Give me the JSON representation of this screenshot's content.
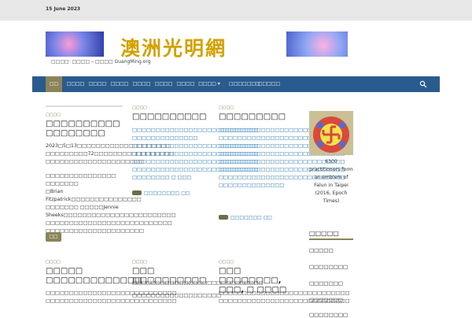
{
  "topbar": {
    "date": "15 June 2023"
  },
  "banner": {
    "title": "澳洲光明網",
    "tagline": "□□□□· □□□□ – □□□□ GuangMing.org"
  },
  "nav": {
    "items": [
      "□□",
      "□□□□",
      "□□□□",
      "□□□□",
      "□□□□",
      "□□□□",
      "□□□□",
      "□□□□",
      "□□□□□□□",
      "□□□□□"
    ],
    "dropdown_indicator": "▾"
  },
  "main": {
    "col1": {
      "tag": "□□□□",
      "headline": "□□□□□□□□□□ □□□□□□□□",
      "body": [
        "2023□5□13□□□□□□□□□□□□□□□□□□□□",
        "□□□□□□□□□72□□□□□□□□□□□□□□□□□",
        "□□□□□□□□□□□□□□□□□□□□□",
        "",
        "□□□□□□□□□□□□□□□ □□□□□□□",
        "□Brian Fitzpatrick□□□□□□□□□□□□□□□",
        "□□□□□□□ □□□□□Jennie",
        "Sheeks□□□□□□□□□□□□□□□□□□□□□□□□",
        "□□□□□□□□□□□□□□□□□□□□□□□□□□□",
        "□□□□□□□□□□□□□□□□□□□□□"
      ],
      "button": "□□"
    },
    "col2": {
      "tag": "□□□□",
      "headline": "□□□□□□□□□□",
      "body": [
        "□□□□□□□□□□□□□□□□□□□□□□□□□□□",
        "□□□□□□□□□□□□□□",
        "□□□□□□□□□□□□□□□□□□□□□□□□□□□",
        "□□□□□□□□□□□□□□□□□□□□□□□□□□□",
        "□□□□□□□□□□□□□□□□□□□□□□□□□□□",
        "□□□□□□□□□□□□□□□□□□□□□□□□□□□",
        "□□□□□□□□ □ □□□"
      ],
      "readmore": "□□□□□□□□ □□"
    },
    "col3": {
      "tag": "□□□□",
      "headline": "□□□□□□□□□",
      "body": [
        "□□□□□□□□□□□□□□□□□□□□□□□□□□□",
        "□□□□□□□□□□□□□□□□□□□□□□□□□□□",
        "□□□□□□□□□□□□□□□□□□□□□□□□□□□",
        "□□□□□□□□□□□□□□□□□□□□□□□□□□□",
        "□□□□□□□□□□□□□□□□□□□□□□□□□□□",
        "□□□□□□□□□□□□□□□□□□□□□□□□□□□",
        "□□□□□□□□□□□□□□□□□□□□□□□□□□□",
        "□□□□□□□□□□□□□□"
      ],
      "readmore": "□□□□□□□ □□"
    },
    "row2": [
      {
        "tag": "□□□□",
        "headline": "□□□□□ □□□□□□□□□□□□□",
        "body": [
          "□□□□□□□□□□□□□□□□□□□□□□□□□□□□",
          "□□□□□□□□□□□□□□□□□□□□□□□□□□□□"
        ]
      },
      {
        "tag": "□□□□",
        "headline": "□□□ □□□□□□□□□□",
        "body": [
          "□□□□□□□□□□□□□□□□□□□□□□□□□□□□",
          "□□□□□□□□□□□□□□□□□□□"
        ]
      },
      {
        "tag": "□□□□",
        "headline": "□□□ □□□□□□□□, □□□, □ □□□□",
        "body": [
          "□□□□□□□□□□□□□□□□□□□□□□□□□□□□",
          "□□□□□□□□□□□□□□□□□□□□□□□□□□□□"
        ]
      }
    ]
  },
  "sidebar": {
    "caption": "6300 practitioners form an emblem of Falun in Taipei (2016, Epoch Times)",
    "heading": "□□□□□",
    "links": [
      "□□□□□",
      "□□□□□□□□",
      "□□□□□□□",
      "□□□□□□□",
      "□□□□□□□□"
    ]
  }
}
